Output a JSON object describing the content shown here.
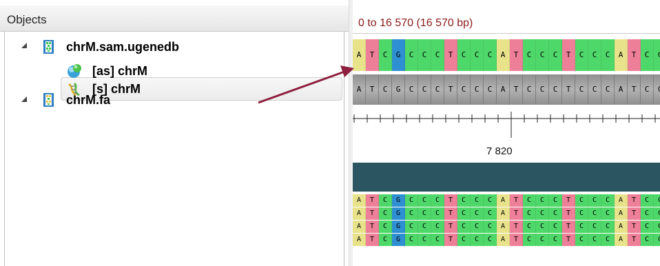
{
  "objects_panel": {
    "title": "Objects",
    "tree": [
      {
        "label": "chrM.sam.ugenedb",
        "icon": "document-icon",
        "expanded": true
      },
      {
        "label": "[as] chrM",
        "icon": "assembly-icon"
      },
      {
        "label": "chrM.fa",
        "icon": "document-icon",
        "expanded": true
      },
      {
        "label": "[s] chrM",
        "icon": "sequence-icon",
        "selected": true
      }
    ]
  },
  "sequence_view": {
    "range": "0 to 16 570 (16 570 bp)",
    "sequence": [
      "A",
      "T",
      "C",
      "G",
      "C",
      "C",
      "C",
      "T",
      "C",
      "C",
      "C",
      "A",
      "T",
      "C",
      "C",
      "C",
      "T",
      "C",
      "C",
      "C",
      "A",
      "T",
      "C",
      "C"
    ],
    "ruler_label": "7 820",
    "read_rows": 4
  },
  "colors": {
    "A": "#e8e38a",
    "T": "#ee7f98",
    "C": "#4fd86a",
    "G": "#2f8fd3",
    "range_text": "#8b1a1a",
    "coverage": "#2b5560",
    "arrow": "#8e1f3e"
  }
}
